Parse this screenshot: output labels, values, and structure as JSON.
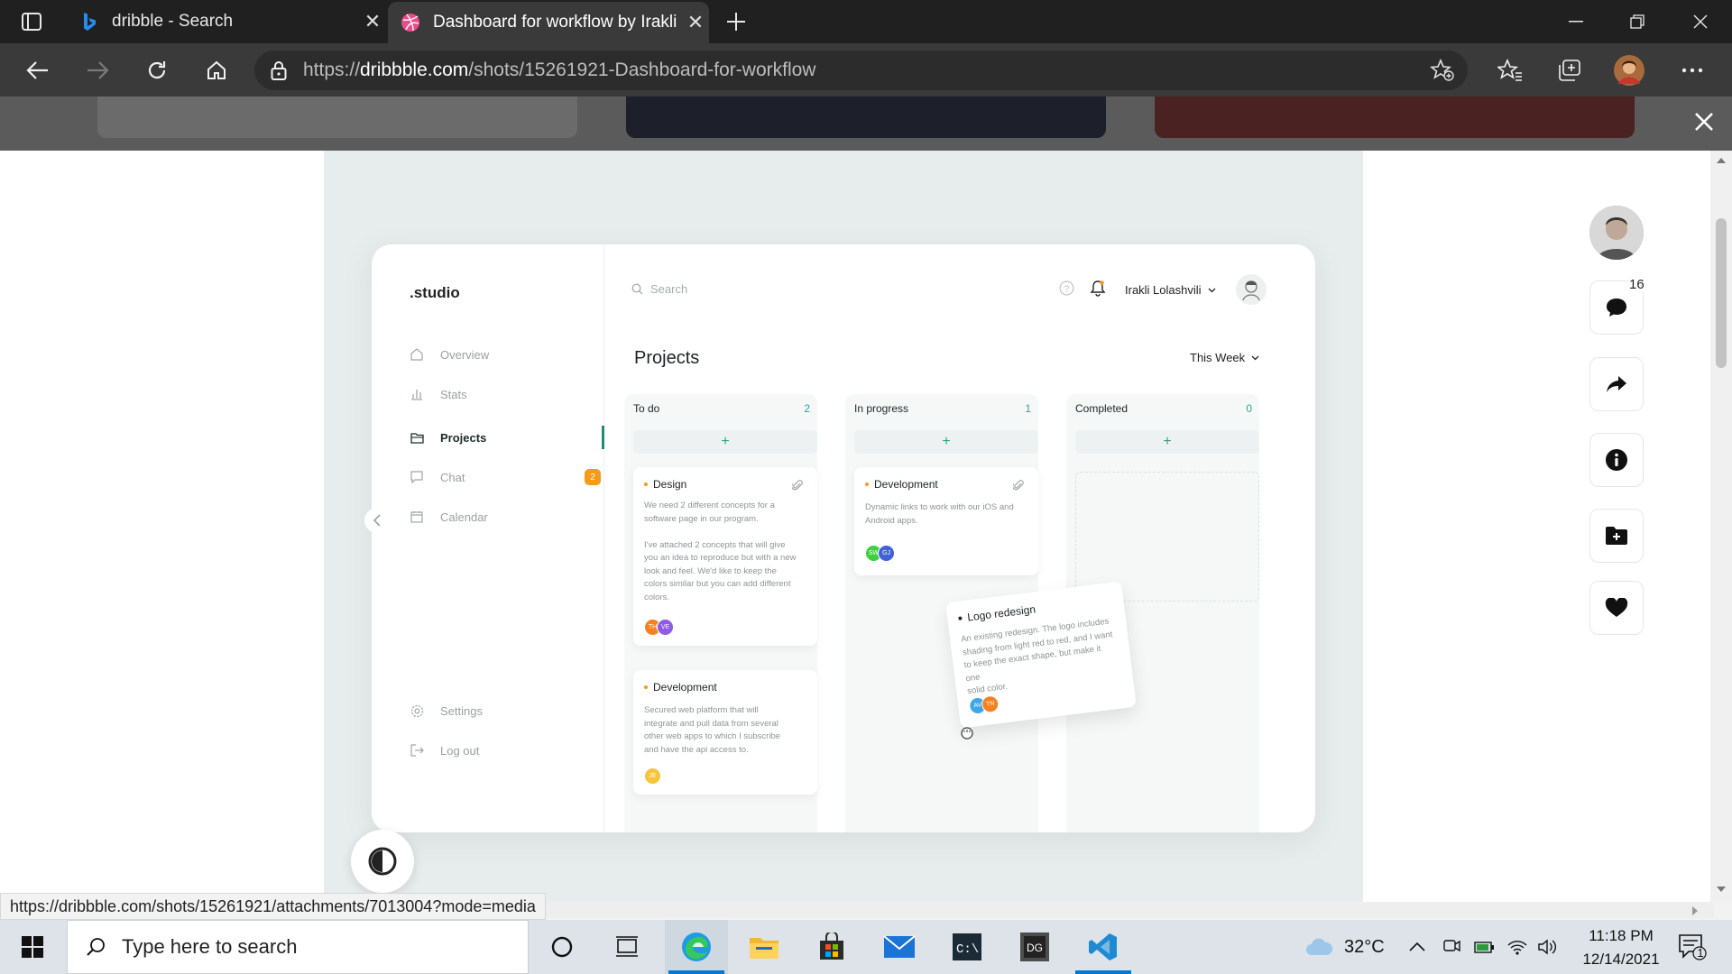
{
  "browser": {
    "tabs": [
      {
        "title": "dribble - Search"
      },
      {
        "title": "Dashboard for workflow by Irakli Lolashvili"
      }
    ],
    "url_scheme": "https://",
    "url_host": "dribbble.com",
    "url_path": "/shots/15261921-Dashboard-for-workflow"
  },
  "dashboard": {
    "brand": ".studio",
    "nav": [
      {
        "label": "Overview"
      },
      {
        "label": "Stats"
      },
      {
        "label": "Projects"
      },
      {
        "label": "Chat",
        "badge": "2"
      },
      {
        "label": "Calendar"
      }
    ],
    "nav_bottom": [
      {
        "label": "Settings"
      },
      {
        "label": "Log out"
      }
    ],
    "search_placeholder": "Search",
    "user_name": "Irakli Lolashvili",
    "page_title": "Projects",
    "period": "This Week",
    "columns": [
      {
        "name": "To do",
        "count": "2"
      },
      {
        "name": "In progress",
        "count": "1"
      },
      {
        "name": "Completed",
        "count": "0"
      }
    ],
    "add_symbol": "+",
    "cards": {
      "todo_design": {
        "title": "Design",
        "body": "We need 2 different concepts for a\nsoftware page in our program.\n\nI've attached 2 concepts that will give\nyou an idea to reproduce but with a new\nlook and feel.  We'd like to keep the\ncolors similar but you can add different\ncolors.",
        "avatars": [
          "TH",
          "VE"
        ]
      },
      "todo_development": {
        "title": "Development",
        "body": "Secured web platform  that will\nintegrate and pull data from several\nother web apps to which I subscribe\nand have the api access to.",
        "avatars": [
          "JE"
        ]
      },
      "progress_development": {
        "title": "Development",
        "body": "Dynamic links to work with our iOS and\nAndroid apps.",
        "avatars": [
          "SW",
          "GJ"
        ]
      },
      "dragging_logo": {
        "title": "Logo redesign",
        "body": "An existing redesign. The logo includes\nshading from light red to red, and I want\nto keep the exact shape, but make it one\nsolid color.",
        "avatars": [
          "AV",
          "TN"
        ]
      }
    }
  },
  "rail": {
    "comments_count": "16"
  },
  "status_url": "https://dribbble.com/shots/15261921/attachments/7013004?mode=media",
  "taskbar": {
    "search_placeholder": "Type here to search",
    "temperature": "32°C",
    "time": "11:18 PM",
    "date": "12/14/2021",
    "notification_count": "1"
  },
  "colors": {
    "accent_green": "#1f8c78",
    "badge_orange": "#f59a1b",
    "chrome_dark": "#202020"
  }
}
